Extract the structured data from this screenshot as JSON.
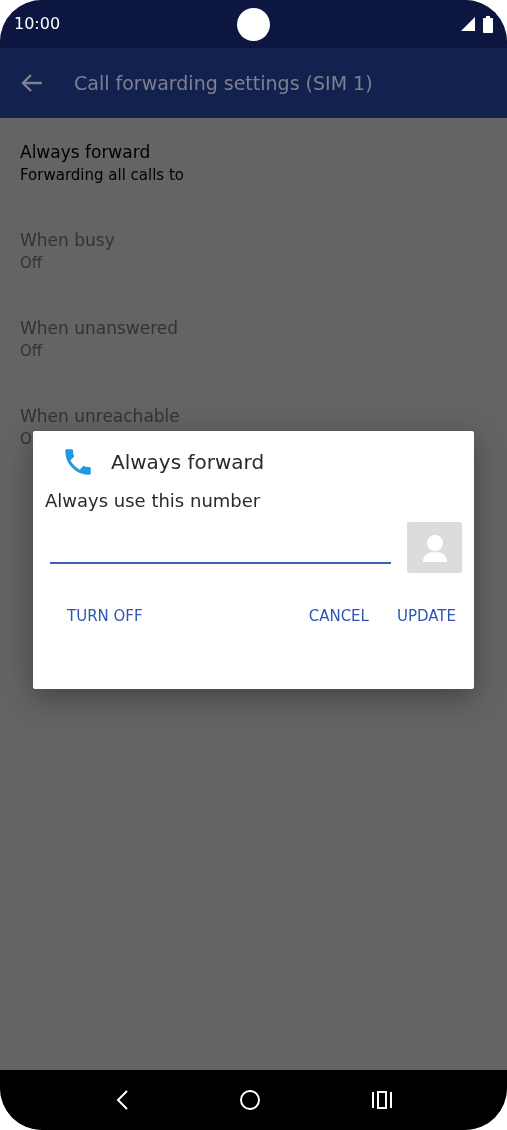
{
  "status_bar": {
    "time": "10:00"
  },
  "app_bar": {
    "title": "Call forwarding settings (SIM 1)"
  },
  "settings": [
    {
      "title": "Always forward",
      "subtitle": "Forwarding all calls to",
      "disabled": false
    },
    {
      "title": "When busy",
      "subtitle": "Off",
      "disabled": true
    },
    {
      "title": "When unanswered",
      "subtitle": "Off",
      "disabled": true
    },
    {
      "title": "When unreachable",
      "subtitle": "O",
      "disabled": true
    }
  ],
  "dialog": {
    "title": "Always forward",
    "label": "Always use this number",
    "buttons": [
      {
        "label": "TURN OFF",
        "kind": "left"
      },
      {
        "label": "CANCEL",
        "kind": "right"
      },
      {
        "label": "UPDATE",
        "kind": "right"
      }
    ]
  }
}
